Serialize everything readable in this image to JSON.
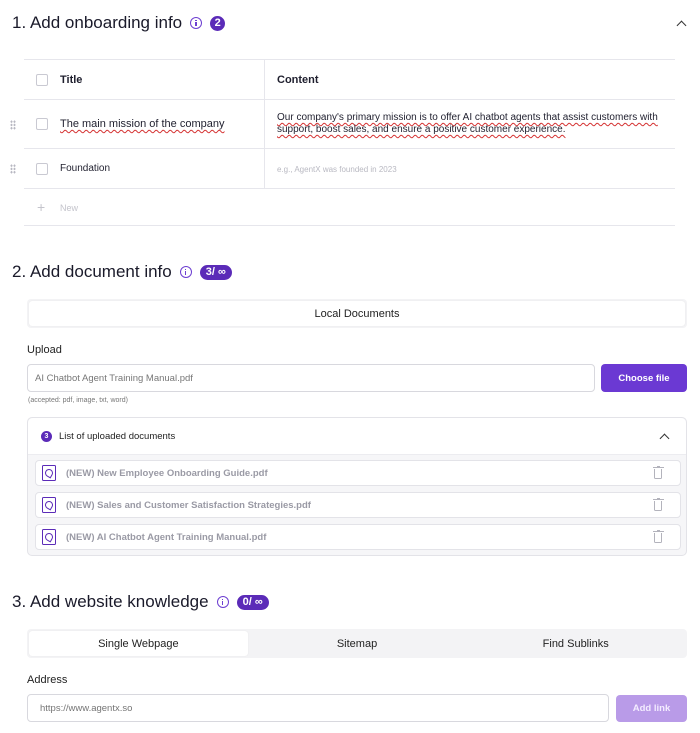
{
  "onboarding": {
    "title": "1. Add onboarding info",
    "count": "2",
    "table": {
      "headers": {
        "title": "Title",
        "content": "Content"
      },
      "rows": [
        {
          "title": "The main mission of the company",
          "content": "Our company's primary mission is to offer AI chatbot agents that assist customers with support, boost sales, and ensure a positive customer experience."
        },
        {
          "title": "Foundation",
          "content": "",
          "content_placeholder": "e.g., AgentX was founded in 2023"
        }
      ],
      "new_label": "New"
    }
  },
  "documents": {
    "title": "2. Add document info",
    "count": "3/ ∞",
    "tabs": [
      "Local Documents"
    ],
    "upload_label": "Upload",
    "upload_value": "AI Chatbot Agent Training Manual.pdf",
    "choose_button": "Choose file",
    "accepted_hint": "(accepted: pdf, image, txt, word)",
    "list": {
      "count": "3",
      "title": "List of uploaded documents",
      "items": [
        "(NEW) New Employee Onboarding Guide.pdf",
        "(NEW) Sales and Customer Satisfaction Strategies.pdf",
        "(NEW) AI Chatbot Agent Training Manual.pdf"
      ]
    }
  },
  "website": {
    "title": "3. Add website knowledge",
    "count": "0/ ∞",
    "tabs": [
      "Single Webpage",
      "Sitemap",
      "Find Sublinks"
    ],
    "address_label": "Address",
    "address_placeholder": "https://www.agentx.so",
    "add_button": "Add link"
  },
  "colors": {
    "accent": "#5b2bb8",
    "button": "#6b39d3",
    "button_disabled": "#b99be8"
  }
}
